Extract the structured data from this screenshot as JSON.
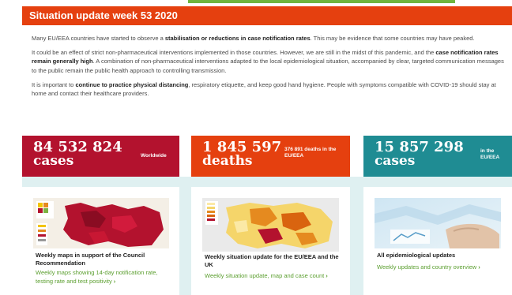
{
  "header": {
    "title": "Situation update week 53 2020"
  },
  "intro": {
    "p1_a": "Many EU/EEA countries have started to observe a ",
    "p1_b": "stabilisation or reductions in case notification rates",
    "p1_c": ". This may be evidence that some countries may have peaked.",
    "p2_a": "It could be an effect of strict non-pharmaceutical interventions implemented in those countries. However, we are still in the midst of this pandemic, and the ",
    "p2_b": "case notification rates remain generally high",
    "p2_c": ". A combination of non-pharmaceutical interventions adapted to the local epidemiological situation, accompanied by clear, targeted communication messages to the public remain the public health approach to controlling transmission.",
    "p3_a": "It is important to ",
    "p3_b": "continue to practice physical distancing",
    "p3_c": ", respiratory etiquette, and keep good hand hygiene. People with symptoms compatible with COVID-19 should stay at home and contact their healthcare providers."
  },
  "stats": {
    "cases": {
      "number": "84 532 824",
      "unit": "cases",
      "note": "Worldwide"
    },
    "deaths": {
      "number": "1 845 597",
      "unit": "deaths",
      "note": "376 891 deaths in the EU/EEA"
    },
    "eu": {
      "number": "15 857 298",
      "unit": "cases",
      "note": "in the EU/EEA"
    }
  },
  "cards": {
    "maps": {
      "title": "Weekly maps in support of the Council Recommendation",
      "link": "Weekly maps showing 14-day notification rate, testing rate and test positivity"
    },
    "situation": {
      "title": "Weekly situation update for the EU/EEA and the UK",
      "link": "Weekly situation update, map and case count"
    },
    "epi": {
      "title": "All epidemiological updates",
      "link": "Weekly updates and country overview"
    }
  },
  "icons": {
    "chevron": "chevron-right-icon"
  },
  "colors": {
    "header": "#e5400f",
    "cases": "#b3122e",
    "deaths": "#e5400f",
    "eu": "#1f8c93",
    "link": "#5a9e2e",
    "cards_bg": "#dff0f1"
  }
}
